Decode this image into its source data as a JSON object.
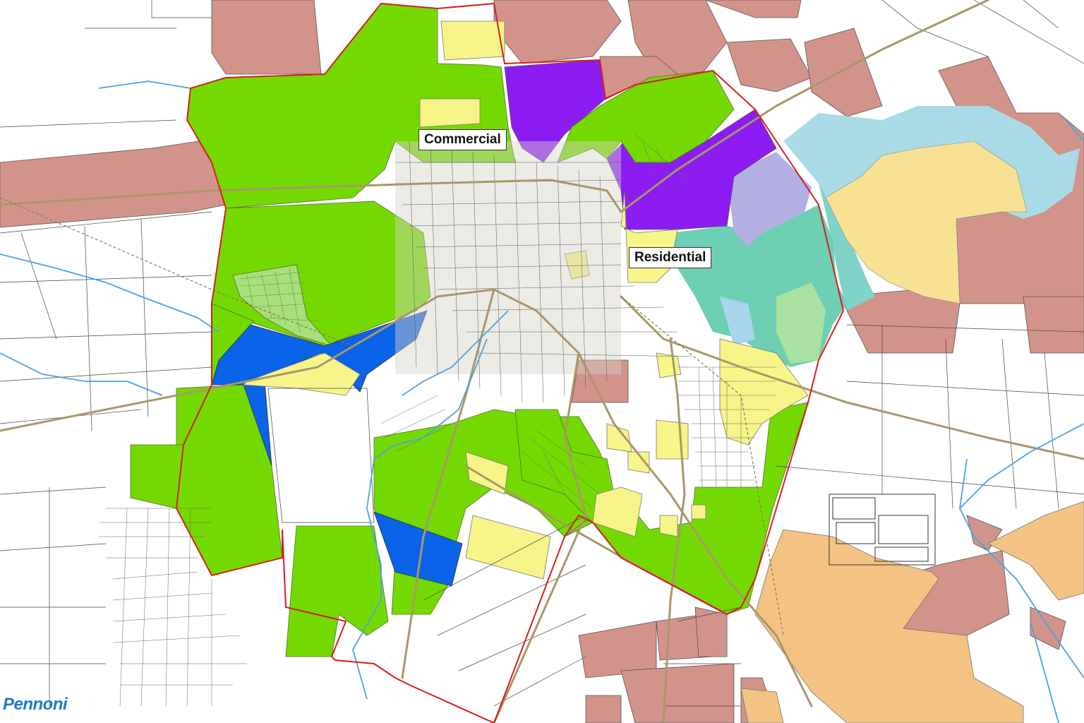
{
  "map": {
    "labels": {
      "commercial": "Commercial",
      "residential": "Residential"
    },
    "logo_text": "Pennoni",
    "colors": {
      "agricultural_green": "#74d900",
      "commercial_yellow": "#f7f48a",
      "industrial_purple": "#8c1cf2",
      "institutional_blue": "#0a63e8",
      "preserved_farmland": "#d2938a",
      "floodplain_lightblue": "#a9dbe6",
      "wetland_teal": "#6dcfb4",
      "lavender": "#b3afe3",
      "pale_yellow": "#f7e293",
      "orange_zone": "#f4c383",
      "boundary_red": "#d61e1e",
      "road_tan": "#a9976a",
      "stream_blue": "#4aa3df",
      "logo_blue": "#1f7bc4"
    }
  }
}
